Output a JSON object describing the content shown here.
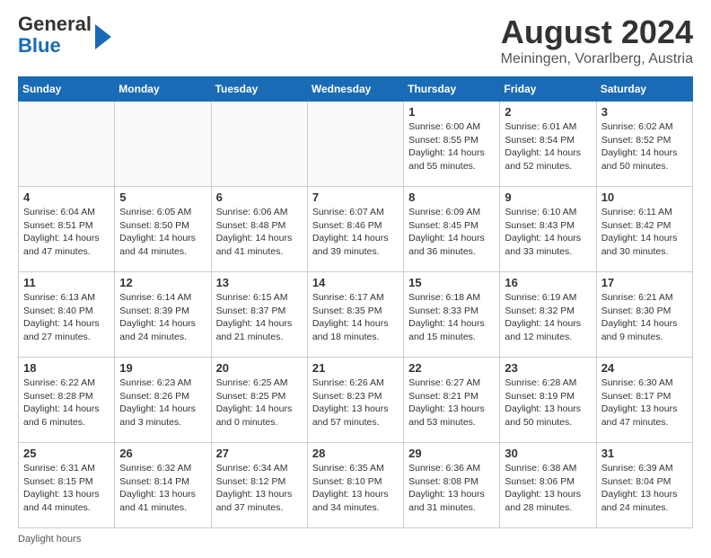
{
  "header": {
    "logo_general": "General",
    "logo_blue": "Blue",
    "title": "August 2024",
    "location": "Meiningen, Vorarlberg, Austria"
  },
  "days_of_week": [
    "Sunday",
    "Monday",
    "Tuesday",
    "Wednesday",
    "Thursday",
    "Friday",
    "Saturday"
  ],
  "weeks": [
    [
      {
        "day": "",
        "info": ""
      },
      {
        "day": "",
        "info": ""
      },
      {
        "day": "",
        "info": ""
      },
      {
        "day": "",
        "info": ""
      },
      {
        "day": "1",
        "info": "Sunrise: 6:00 AM\nSunset: 8:55 PM\nDaylight: 14 hours and 55 minutes."
      },
      {
        "day": "2",
        "info": "Sunrise: 6:01 AM\nSunset: 8:54 PM\nDaylight: 14 hours and 52 minutes."
      },
      {
        "day": "3",
        "info": "Sunrise: 6:02 AM\nSunset: 8:52 PM\nDaylight: 14 hours and 50 minutes."
      }
    ],
    [
      {
        "day": "4",
        "info": "Sunrise: 6:04 AM\nSunset: 8:51 PM\nDaylight: 14 hours and 47 minutes."
      },
      {
        "day": "5",
        "info": "Sunrise: 6:05 AM\nSunset: 8:50 PM\nDaylight: 14 hours and 44 minutes."
      },
      {
        "day": "6",
        "info": "Sunrise: 6:06 AM\nSunset: 8:48 PM\nDaylight: 14 hours and 41 minutes."
      },
      {
        "day": "7",
        "info": "Sunrise: 6:07 AM\nSunset: 8:46 PM\nDaylight: 14 hours and 39 minutes."
      },
      {
        "day": "8",
        "info": "Sunrise: 6:09 AM\nSunset: 8:45 PM\nDaylight: 14 hours and 36 minutes."
      },
      {
        "day": "9",
        "info": "Sunrise: 6:10 AM\nSunset: 8:43 PM\nDaylight: 14 hours and 33 minutes."
      },
      {
        "day": "10",
        "info": "Sunrise: 6:11 AM\nSunset: 8:42 PM\nDaylight: 14 hours and 30 minutes."
      }
    ],
    [
      {
        "day": "11",
        "info": "Sunrise: 6:13 AM\nSunset: 8:40 PM\nDaylight: 14 hours and 27 minutes."
      },
      {
        "day": "12",
        "info": "Sunrise: 6:14 AM\nSunset: 8:39 PM\nDaylight: 14 hours and 24 minutes."
      },
      {
        "day": "13",
        "info": "Sunrise: 6:15 AM\nSunset: 8:37 PM\nDaylight: 14 hours and 21 minutes."
      },
      {
        "day": "14",
        "info": "Sunrise: 6:17 AM\nSunset: 8:35 PM\nDaylight: 14 hours and 18 minutes."
      },
      {
        "day": "15",
        "info": "Sunrise: 6:18 AM\nSunset: 8:33 PM\nDaylight: 14 hours and 15 minutes."
      },
      {
        "day": "16",
        "info": "Sunrise: 6:19 AM\nSunset: 8:32 PM\nDaylight: 14 hours and 12 minutes."
      },
      {
        "day": "17",
        "info": "Sunrise: 6:21 AM\nSunset: 8:30 PM\nDaylight: 14 hours and 9 minutes."
      }
    ],
    [
      {
        "day": "18",
        "info": "Sunrise: 6:22 AM\nSunset: 8:28 PM\nDaylight: 14 hours and 6 minutes."
      },
      {
        "day": "19",
        "info": "Sunrise: 6:23 AM\nSunset: 8:26 PM\nDaylight: 14 hours and 3 minutes."
      },
      {
        "day": "20",
        "info": "Sunrise: 6:25 AM\nSunset: 8:25 PM\nDaylight: 14 hours and 0 minutes."
      },
      {
        "day": "21",
        "info": "Sunrise: 6:26 AM\nSunset: 8:23 PM\nDaylight: 13 hours and 57 minutes."
      },
      {
        "day": "22",
        "info": "Sunrise: 6:27 AM\nSunset: 8:21 PM\nDaylight: 13 hours and 53 minutes."
      },
      {
        "day": "23",
        "info": "Sunrise: 6:28 AM\nSunset: 8:19 PM\nDaylight: 13 hours and 50 minutes."
      },
      {
        "day": "24",
        "info": "Sunrise: 6:30 AM\nSunset: 8:17 PM\nDaylight: 13 hours and 47 minutes."
      }
    ],
    [
      {
        "day": "25",
        "info": "Sunrise: 6:31 AM\nSunset: 8:15 PM\nDaylight: 13 hours and 44 minutes."
      },
      {
        "day": "26",
        "info": "Sunrise: 6:32 AM\nSunset: 8:14 PM\nDaylight: 13 hours and 41 minutes."
      },
      {
        "day": "27",
        "info": "Sunrise: 6:34 AM\nSunset: 8:12 PM\nDaylight: 13 hours and 37 minutes."
      },
      {
        "day": "28",
        "info": "Sunrise: 6:35 AM\nSunset: 8:10 PM\nDaylight: 13 hours and 34 minutes."
      },
      {
        "day": "29",
        "info": "Sunrise: 6:36 AM\nSunset: 8:08 PM\nDaylight: 13 hours and 31 minutes."
      },
      {
        "day": "30",
        "info": "Sunrise: 6:38 AM\nSunset: 8:06 PM\nDaylight: 13 hours and 28 minutes."
      },
      {
        "day": "31",
        "info": "Sunrise: 6:39 AM\nSunset: 8:04 PM\nDaylight: 13 hours and 24 minutes."
      }
    ]
  ],
  "footer": {
    "daylight_label": "Daylight hours"
  }
}
